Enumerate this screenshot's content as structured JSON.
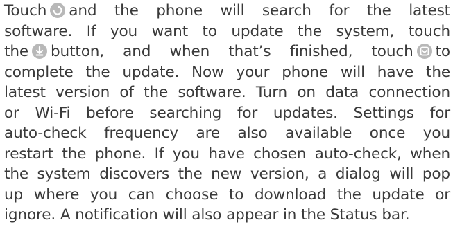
{
  "paragraph": {
    "line1": {
      "a": "Touch",
      "b": "and the phone will search for the latest"
    },
    "line2": "software. If you want to update the system, touch",
    "line3": {
      "a": "the",
      "b": "button, and when that’s finished, touch",
      "c": "to"
    },
    "line4": "complete the update. Now your phone will have the",
    "line5": "latest version of the software. Turn on data connection",
    "line6": "or Wi-Fi before searching for updates. Settings for",
    "line7": "auto-check frequency are also available once you",
    "line8": "restart the phone. If you have chosen auto-check, when",
    "line9": "the system discovers the new version, a dialog will pop",
    "line10": "up where you can choose to download the update or",
    "line11": "ignore. A notification will also appear in the Status bar."
  },
  "icons": {
    "refresh": "refresh-icon",
    "download": "download-icon",
    "install": "install-icon"
  },
  "colors": {
    "text": "#3a3a3a",
    "icon_fill": "#b8b8b8",
    "icon_glyph": "#ffffff"
  }
}
